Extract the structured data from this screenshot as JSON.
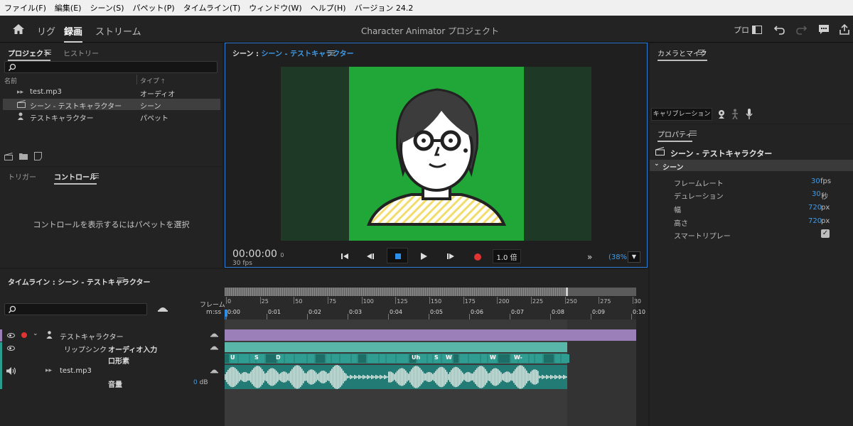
{
  "menu": [
    "ファイル(F)",
    "編集(E)",
    "シーン(S)",
    "パペット(P)",
    "タイムライン(T)",
    "ウィンドウ(W)",
    "ヘルプ(H)",
    "バージョン 24.2"
  ],
  "header": {
    "modes": [
      "リグ",
      "録画",
      "ストリーム"
    ],
    "active_mode": "録画",
    "app_title": "Character Animator プロジェクト",
    "pro_label": "プロ"
  },
  "project": {
    "tabs": [
      "プロジェクト",
      "ヒストリー"
    ],
    "col_name": "名前",
    "col_type": "タイプ",
    "rows": [
      {
        "name": "test.mp3",
        "type": "オーディオ",
        "icon": "audio-icon"
      },
      {
        "name": "シーン - テストキャラクター",
        "type": "シーン",
        "icon": "scene-icon"
      },
      {
        "name": "テストキャラクター",
        "type": "パペット",
        "icon": "puppet-icon"
      }
    ],
    "selected_row": 1
  },
  "controls": {
    "tabs": [
      "トリガー",
      "コントロール"
    ],
    "empty_message": "コントロールを表示するにはパペットを選択"
  },
  "scene": {
    "title_prefix": "シーン : ",
    "title_link": "シーン - テストキャラクター",
    "timecode": "00:00:00",
    "timecode_suffix": "0",
    "fps": "30 fps",
    "speed": "1.0 倍",
    "zoom": "(38%)",
    "stage_color": "#21a738"
  },
  "camera": {
    "title": "カメラとマイク",
    "calibrate": "キャリブレーション"
  },
  "properties": {
    "title": "プロパティ",
    "name": "シーン - テストキャラクター",
    "section": "シーン",
    "rows": [
      {
        "label": "フレームレート",
        "value": "30",
        "unit": "fps"
      },
      {
        "label": "デュレーション",
        "value": "30",
        "unit": "秒"
      },
      {
        "label": "幅",
        "value": "720",
        "unit": "px"
      },
      {
        "label": "高さ",
        "value": "720",
        "unit": "px"
      },
      {
        "label": "スマートリプレー",
        "checked": true
      }
    ]
  },
  "timeline": {
    "title": "タイムライン : シーン - テストキャラクター",
    "frame_label": "フレーム",
    "time_label": "m:ss",
    "frame_ticks": [
      "0",
      "25",
      "50",
      "75",
      "100",
      "125",
      "150",
      "175",
      "200",
      "225",
      "250",
      "275",
      "30"
    ],
    "time_ticks": [
      "0:00",
      "0:01",
      "0:02",
      "0:03",
      "0:04",
      "0:05",
      "0:06",
      "0:07",
      "0:08",
      "0:09",
      "0:10"
    ],
    "tracks": {
      "puppet": "テストキャラクター",
      "lipsync": "リップシンク",
      "audio_input": "オーディオ入力",
      "mouth_shape": "口形素",
      "audio": "test.mp3",
      "volume": "音量",
      "volume_value": "0",
      "volume_unit": "dB"
    },
    "visemes": [
      "U",
      "S",
      "D",
      "Uh",
      "S",
      "W",
      "W",
      "W-"
    ]
  }
}
